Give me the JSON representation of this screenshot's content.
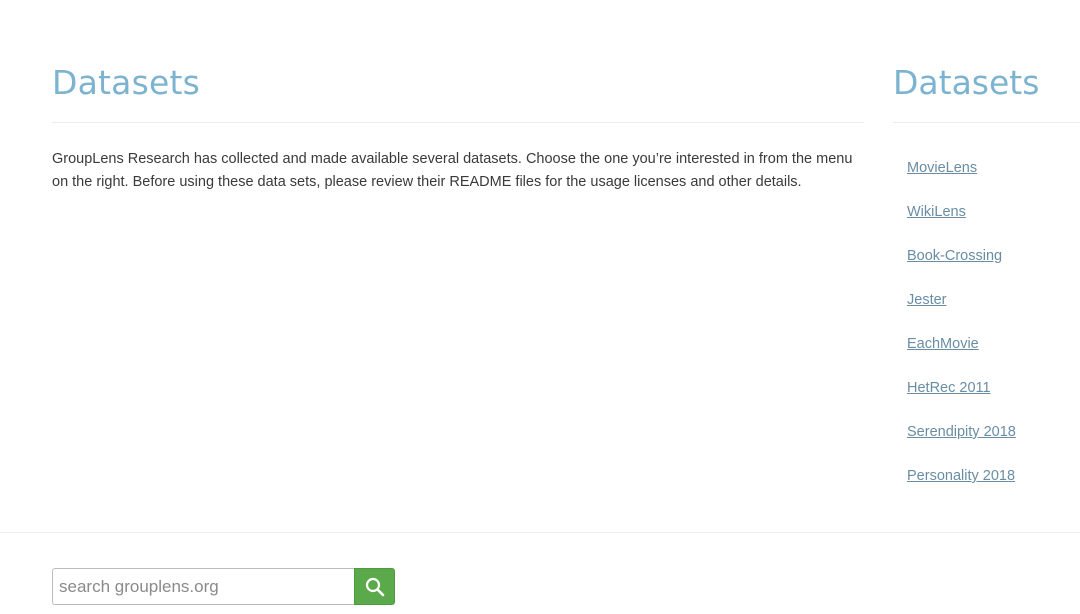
{
  "main": {
    "title": "Datasets",
    "intro": "GroupLens Research has collected and made available several datasets. Choose the one you’re interested in from the menu on the right. Before using these data sets, please review their README files for the usage licenses and other details."
  },
  "sidebar": {
    "title": "Datasets",
    "items": [
      {
        "label": "MovieLens"
      },
      {
        "label": "WikiLens"
      },
      {
        "label": "Book-Crossing"
      },
      {
        "label": "Jester"
      },
      {
        "label": "EachMovie"
      },
      {
        "label": "HetRec 2011"
      },
      {
        "label": "Serendipity 2018"
      },
      {
        "label": "Personality 2018"
      }
    ]
  },
  "search": {
    "placeholder": "search grouplens.org",
    "button_icon": "search-icon"
  },
  "colors": {
    "heading": "#7bb3d0",
    "link": "#6a8da3",
    "search_button": "#5aa94a"
  }
}
